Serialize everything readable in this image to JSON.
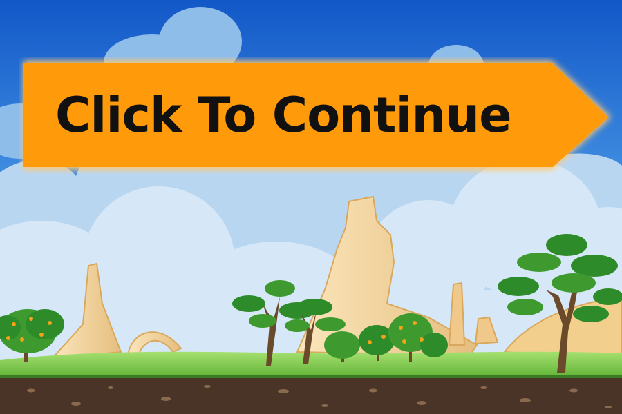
{
  "screen": "title",
  "continue_button": {
    "label": "Click To Continue",
    "fill_color": "#FF9A0A",
    "glow_color": "#FFC870",
    "text_color": "#111111"
  },
  "scene": {
    "sky_top_color": "#1560CC",
    "sky_bottom_color": "#CFE3F4",
    "grass_color": "#7ACB45",
    "soil_color": "#4A3327",
    "rock_color": "#F2D39A",
    "tree_leaf_color": "#2E8B2A",
    "fruit_color": "#F4A21A"
  }
}
